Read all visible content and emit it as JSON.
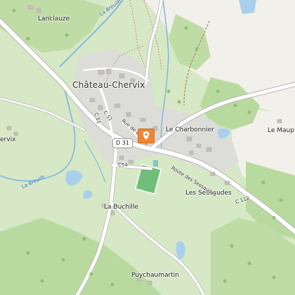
{
  "map": {
    "labels": {
      "town": "Château-Chervix",
      "lanclauze": "Lanclauze",
      "le_charbonnier": "Le Charbonnier",
      "le_maup": "Le Maup",
      "chervix": "ervix",
      "la_buchille": "La Buchille",
      "les_sessaudes": "Les Sessaudes",
      "puychaumartin": "Puychaumartin"
    },
    "roads": {
      "d31": "D 31",
      "c54": "C54",
      "c112": "C 112",
      "c51": "C 51",
      "c51b": "C 51",
      "rue_de_b": "Rue de B",
      "route_sessaudes": "Route des Sessaudes"
    },
    "rivers": {
      "breuilh_top": "La Breuilh",
      "breuilh_left": "La Breuilh"
    },
    "marker_icon": "location-marker-icon",
    "colors": {
      "meadow": "#d6e8c5",
      "forest": "#b9da9f",
      "built": "#dcdcd8",
      "road": "#ffffff",
      "road_casing": "#b5b5b5",
      "water": "#a8d0ec",
      "marker": "#f08532",
      "path": "#b08a5a"
    }
  }
}
